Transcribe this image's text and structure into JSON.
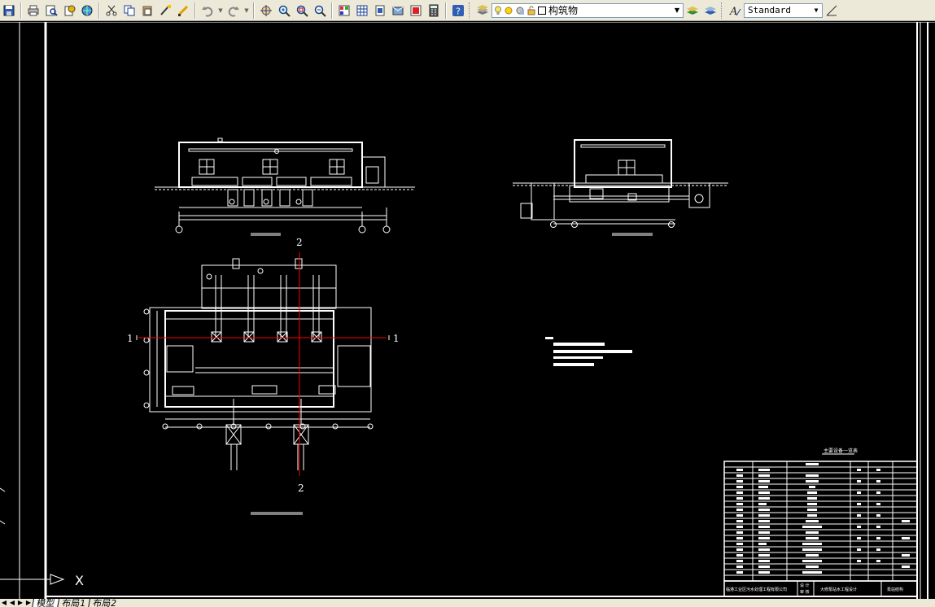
{
  "toolbar": {
    "layer_name": "构筑物",
    "text_style": "Standard"
  },
  "drawing": {
    "title_block": {
      "company": "临港工业区污水处理工程有限公司",
      "project": "大修泵站水工程设计",
      "sheet": "泵站结构",
      "design_label": "设 计",
      "review_label": "审 核"
    },
    "table_title": "主要设备一览表",
    "section_marker_1": "1",
    "section_marker_2": "2",
    "ucs_label": "X"
  },
  "tabs": [
    {
      "label": "模型",
      "active": true
    },
    {
      "label": "布局1",
      "active": false
    },
    {
      "label": "布局2",
      "active": false
    }
  ],
  "colors": {
    "toolbar_bg": "#ece9d8",
    "canvas_bg": "#000000",
    "line_white": "#ffffff",
    "section_red": "#ff0000"
  }
}
